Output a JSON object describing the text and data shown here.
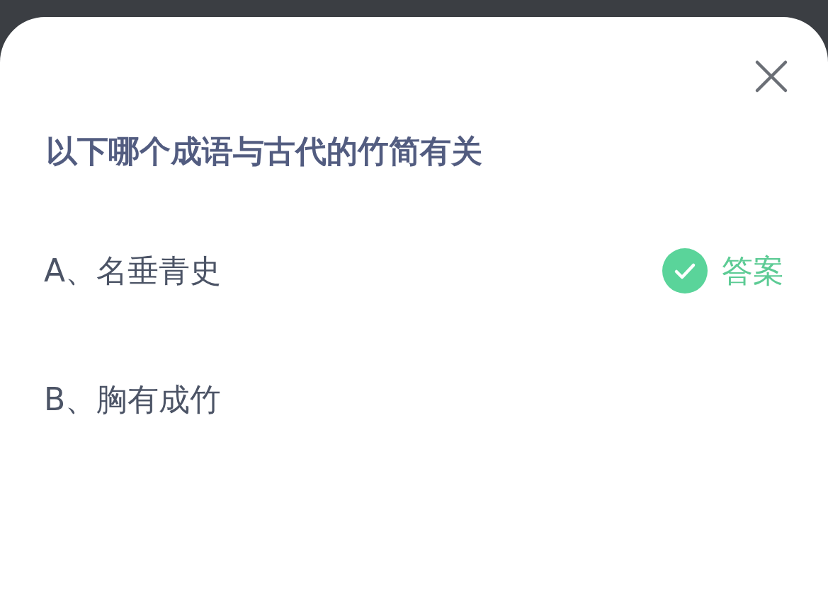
{
  "question": {
    "title": "以下哪个成语与古代的竹简有关"
  },
  "answer_label": "答案",
  "options": [
    {
      "text": "A、名垂青史",
      "correct": true
    },
    {
      "text": "B、胸有成竹",
      "correct": false
    }
  ]
}
